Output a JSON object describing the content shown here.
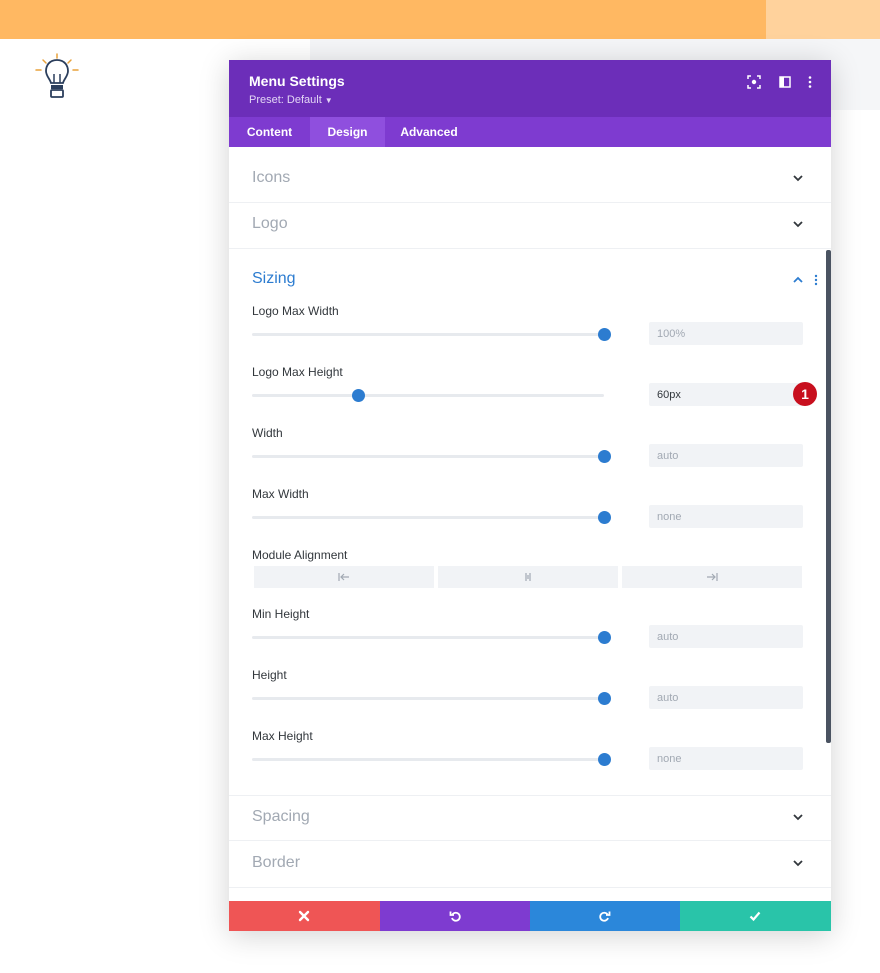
{
  "modal": {
    "title": "Menu Settings",
    "preset": "Preset: Default"
  },
  "tabs": [
    {
      "label": "Content",
      "active": false
    },
    {
      "label": "Design",
      "active": true
    },
    {
      "label": "Advanced",
      "active": false
    }
  ],
  "sections": {
    "icons": "Icons",
    "logo": "Logo",
    "sizing": "Sizing",
    "spacing": "Spacing",
    "border": "Border"
  },
  "sizing_fields": [
    {
      "label": "Logo Max Width",
      "value": "100%",
      "slider_level": 1.0
    },
    {
      "label": "Logo Max Height",
      "value": "60px",
      "slider_level": 0.3
    },
    {
      "label": "Width",
      "value": "auto",
      "slider_level": 1.0
    },
    {
      "label": "Max Width",
      "value": "none",
      "slider_level": 1.0
    },
    {
      "label": "Min Height",
      "value": "auto",
      "slider_level": 1.0
    },
    {
      "label": "Height",
      "value": "auto",
      "slider_level": 1.0
    },
    {
      "label": "Max Height",
      "value": "none",
      "slider_level": 1.0
    }
  ],
  "module_alignment": {
    "label": "Module Alignment",
    "options": [
      "align-left-icon",
      "align-center-icon",
      "align-right-icon"
    ]
  },
  "annotation_badge": "1",
  "colors": {
    "header": "#6c2eb9",
    "tabs": "#7e3bd0",
    "accent": "#2c7cd0",
    "cancel": "#ef5555",
    "undo": "#7e3bd0",
    "redo": "#2b87da",
    "save": "#29c4a9",
    "badge": "#c80f1e"
  },
  "footer": [
    "close-icon",
    "undo-icon",
    "redo-icon",
    "check-icon"
  ]
}
